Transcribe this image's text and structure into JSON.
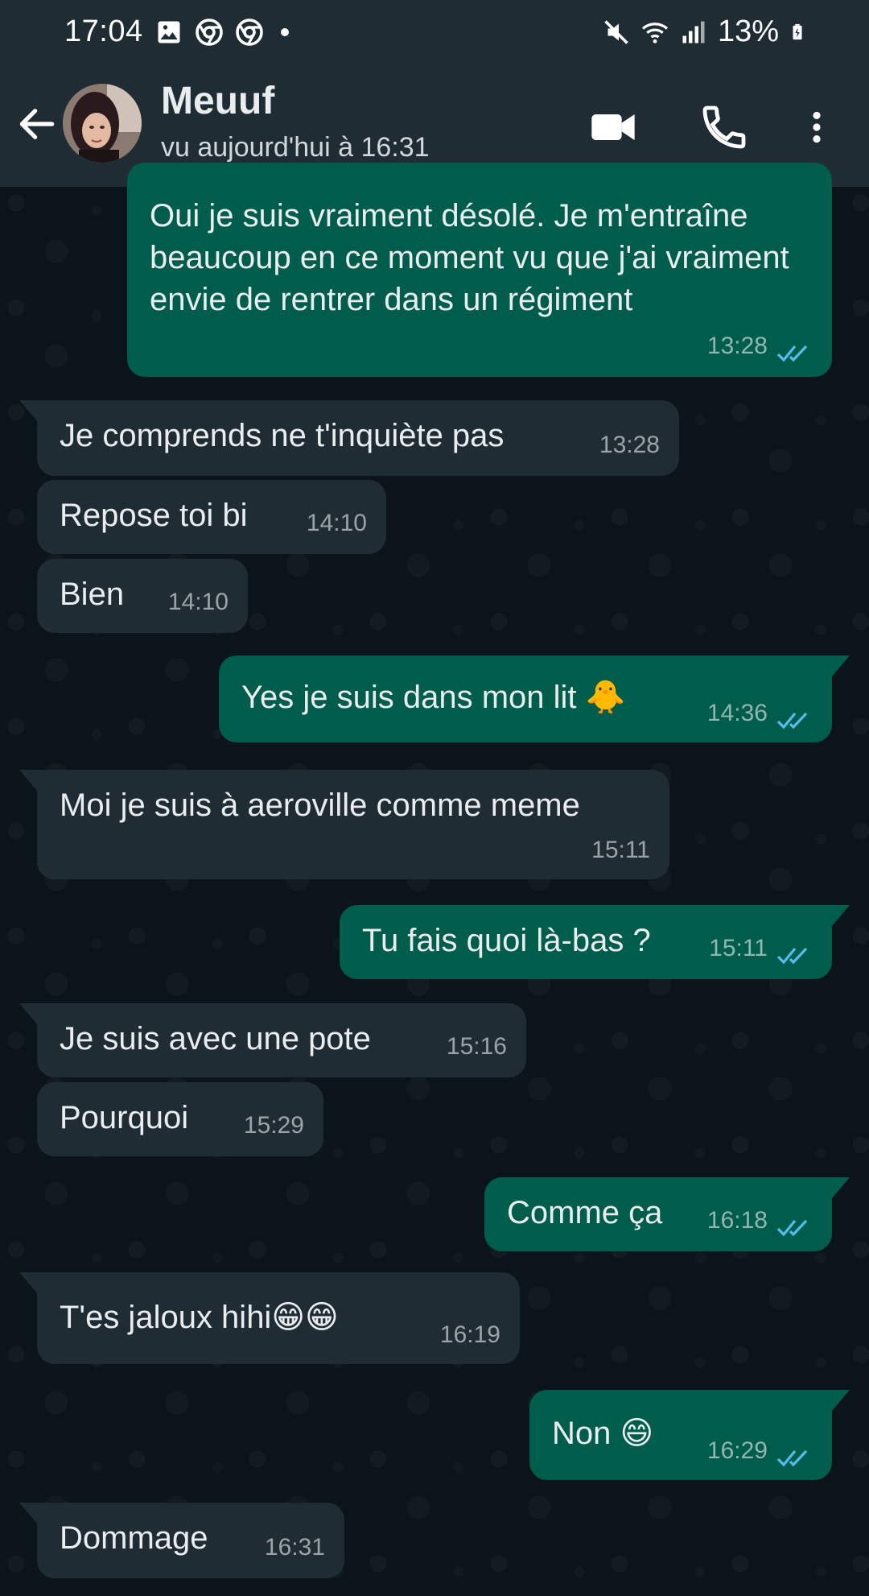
{
  "status_bar": {
    "time": "17:04",
    "battery": "13%",
    "icons": [
      "gallery-icon",
      "chrome-icon",
      "chrome-icon",
      "dot-icon",
      "mute-icon",
      "wifi-icon",
      "signal-icon",
      "battery-charging-icon"
    ]
  },
  "header": {
    "contact_name": "Meuuf",
    "last_seen": "vu aujourd'hui à 16:31",
    "icons": [
      "back-arrow-icon",
      "video-call-icon",
      "phone-icon",
      "more-vert-icon"
    ]
  },
  "colors": {
    "header_bg": "#1f2c33",
    "chat_bg": "#0b141a",
    "incoming_bubble": "#202c33",
    "outgoing_bubble": "#005c4b",
    "read_tick": "#53bdeb"
  },
  "messages": [
    {
      "dir": "out",
      "text": "Oui je suis vraiment désolé. Je m'entraîne beaucoup en ce moment vu que j'ai vraiment envie de rentrer dans un régiment",
      "time": "13:28",
      "status": "read"
    },
    {
      "dir": "in",
      "text": "Je comprends ne t'inquiète pas",
      "time": "13:28"
    },
    {
      "dir": "in",
      "text": "Repose toi bi",
      "time": "14:10"
    },
    {
      "dir": "in",
      "text": "Bien",
      "time": "14:10"
    },
    {
      "dir": "out",
      "text": "Yes je suis dans mon lit 🐥",
      "time": "14:36",
      "status": "read"
    },
    {
      "dir": "in",
      "text": "Moi je suis à aeroville comme meme",
      "time": "15:11"
    },
    {
      "dir": "out",
      "text": "Tu fais quoi là-bas ?",
      "time": "15:11",
      "status": "read"
    },
    {
      "dir": "in",
      "text": "Je suis avec une pote",
      "time": "15:16"
    },
    {
      "dir": "in",
      "text": "Pourquoi",
      "time": "15:29"
    },
    {
      "dir": "out",
      "text": "Comme ça",
      "time": "16:18",
      "status": "read"
    },
    {
      "dir": "in",
      "text": "T'es jaloux hihi😁😁",
      "time": "16:19"
    },
    {
      "dir": "out",
      "text": "Non 😄",
      "time": "16:29",
      "status": "read"
    },
    {
      "dir": "in",
      "text": "Dommage",
      "time": "16:31"
    }
  ]
}
